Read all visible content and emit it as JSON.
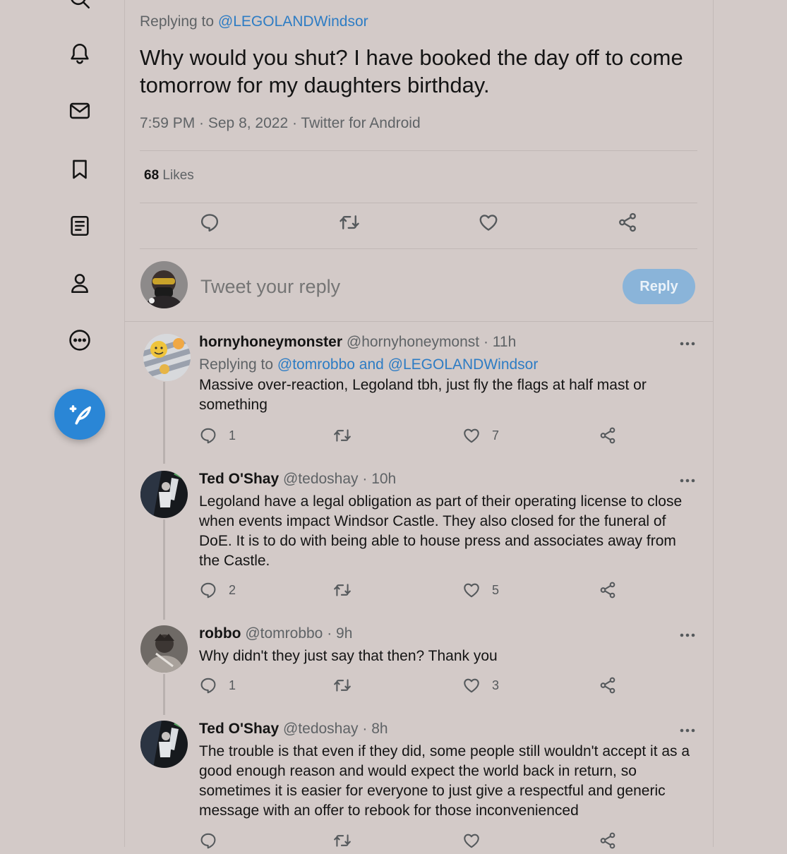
{
  "sidebar": {
    "items": [
      {
        "icon": "search-icon"
      },
      {
        "icon": "bell-icon"
      },
      {
        "icon": "mail-icon"
      },
      {
        "icon": "bookmark-icon"
      },
      {
        "icon": "lists-icon"
      },
      {
        "icon": "profile-icon"
      },
      {
        "icon": "more-circle-icon"
      }
    ],
    "compose_icon": "compose-feather-icon",
    "accent_color": "#2a86d6"
  },
  "tweet": {
    "replying_prefix": "Replying to ",
    "replying_to": "@LEGOLANDWindsor",
    "text": "Why would you shut? I have booked the day off to come tomorrow for my daughters birthday.",
    "meta": "7:59 PM · Sep 8, 2022 · Twitter for Android",
    "likes_count": "68",
    "likes_label": " Likes"
  },
  "compose": {
    "placeholder": "Tweet your reply",
    "button": "Reply"
  },
  "replies": [
    {
      "name": "hornyhoneymonster",
      "handle": "@hornyhoneymonst · 11h",
      "replying_prefix": "Replying to ",
      "replying_to": "@tomrobbo and @LEGOLANDWindsor",
      "text": "Massive over-reaction, Legoland tbh, just fly the flags at half mast or something",
      "reply_count": "1",
      "like_count": "7"
    },
    {
      "name": "Ted O'Shay",
      "handle": "@tedoshay · 10h",
      "text": "Legoland have a legal obligation as part of their operating license to close when events impact Windsor Castle. They also closed for the funeral of DoE. It is to do with being able to house press and associates away from the Castle.",
      "reply_count": "2",
      "like_count": "5"
    },
    {
      "name": "robbo",
      "handle": "@tomrobbo · 9h",
      "text": "Why didn't they just say that then? Thank you",
      "reply_count": "1",
      "like_count": "3"
    },
    {
      "name": "Ted O'Shay",
      "handle": "@tedoshay · 8h",
      "text": "The trouble is that even if they did, some people still wouldn't accept it as a good enough reason and would expect the world back in return, so sometimes it is easier for everyone to just give a respectful and generic message with an offer to rebook for those inconvenienced",
      "reply_count": "",
      "like_count": ""
    }
  ]
}
